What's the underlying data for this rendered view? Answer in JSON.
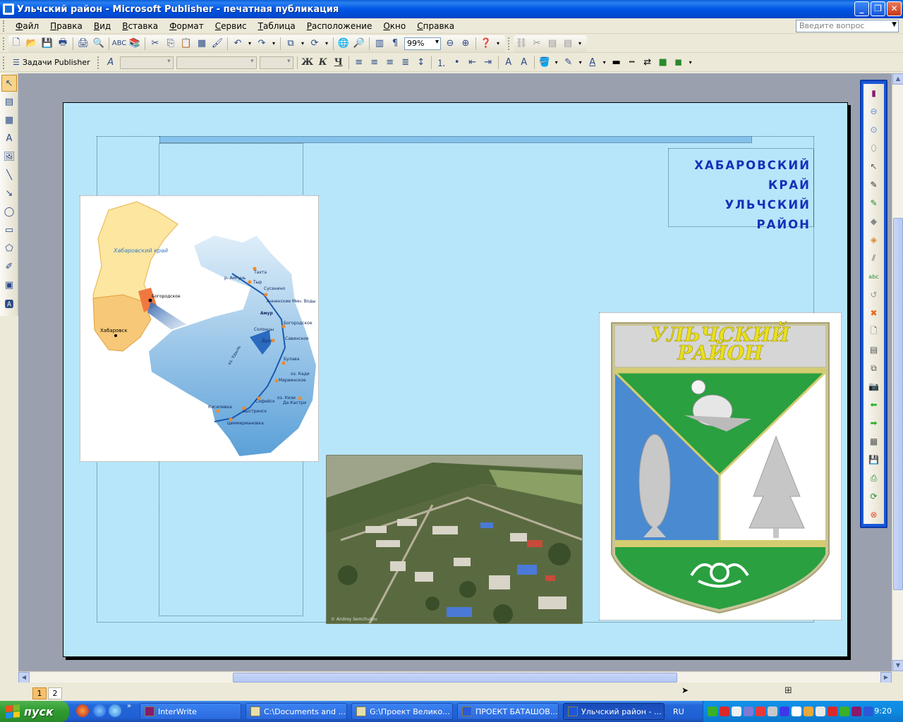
{
  "window": {
    "title": "Ульчский район - Microsoft Publisher - печатная публикация"
  },
  "menu": [
    "Файл",
    "Правка",
    "Вид",
    "Вставка",
    "Формат",
    "Сервис",
    "Таблица",
    "Расположение",
    "Окно",
    "Справка"
  ],
  "help_box": {
    "placeholder": "Введите вопрос"
  },
  "toolbar": {
    "zoom": "99%",
    "tasks_label": "Задачи Publisher"
  },
  "document": {
    "heading": [
      "ХАБАРОВСКИЙ",
      "КРАЙ",
      "УЛЬЧСКИЙ РАЙОН"
    ],
    "map": {
      "region_label": "Хабаровский край",
      "city": "Хабаровск",
      "river": "Амур",
      "places": [
        "р. Амгунь",
        "Тахта",
        "Тыр",
        "Сусанино",
        "Анненские Мин. Воды",
        "Богородское",
        "Солонцы",
        "Дуди",
        "Савинское",
        "оз. Удыль",
        "Булава",
        "оз. Кади",
        "Мариинское",
        "оз. Кизи",
        "Де-Кастри",
        "Софийск",
        "Кисилевка",
        "Быстринск",
        "Циммермановка"
      ]
    },
    "crest_title": [
      "УЛЬЧСКИЙ",
      "РАЙОН"
    ],
    "photo_credit": "© Andrey Semchukov"
  },
  "pages": [
    "1",
    "2"
  ],
  "taskbar": {
    "start": "пуск",
    "tasks": [
      "InterWrite",
      "C:\\Documents and ...",
      "G:\\Проект Велико...",
      "ПРОЕКТ БАТАШОВ...",
      "Ульчский район - ..."
    ],
    "lang": "RU",
    "clock": "9:20"
  }
}
